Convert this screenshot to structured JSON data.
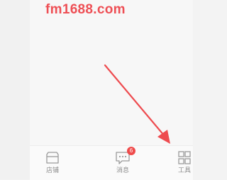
{
  "watermark": "fm1688.com",
  "tabbar": {
    "tabs": [
      {
        "label": "店铺",
        "icon": "store-icon"
      },
      {
        "label": "消息",
        "icon": "message-icon",
        "badge": "6"
      },
      {
        "label": "工具",
        "icon": "grid-tools-icon"
      }
    ]
  },
  "colors": {
    "watermark": "#ee4f55",
    "arrow": "#ee4b4f",
    "badge": "#ef4b4b",
    "icon": "#9a9a9a",
    "tab_label": "#8e8e8e"
  }
}
